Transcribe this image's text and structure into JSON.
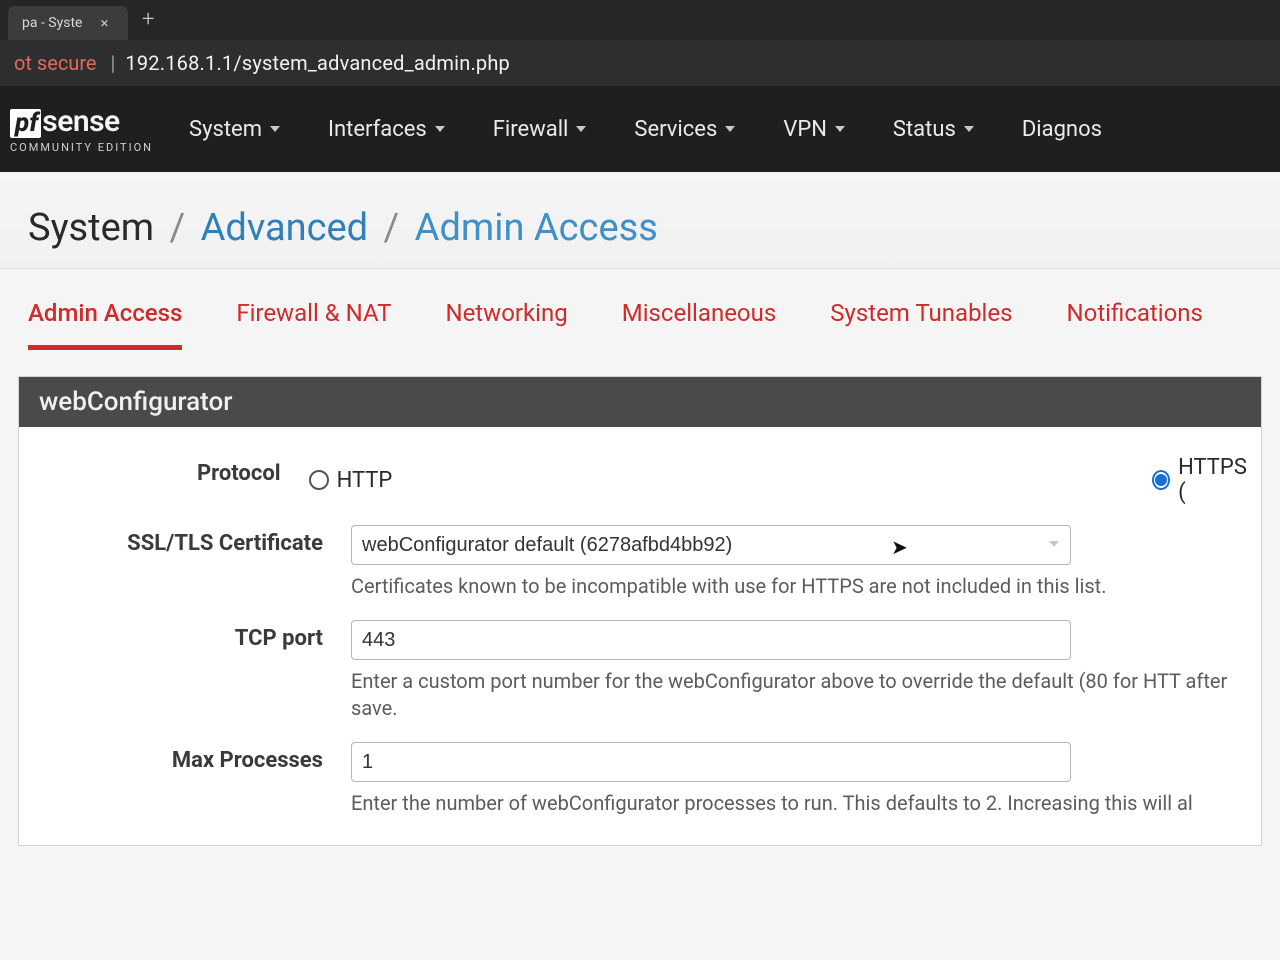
{
  "browser": {
    "tab_title": "pa - Syste",
    "security_label": "ot secure",
    "url": "192.168.1.1/system_advanced_admin.php"
  },
  "brand": {
    "prefix": "pf",
    "name": "sense",
    "edition": "COMMUNITY EDITION"
  },
  "nav": {
    "items": [
      "System",
      "Interfaces",
      "Firewall",
      "Services",
      "VPN",
      "Status",
      "Diagnos"
    ]
  },
  "breadcrumb": {
    "root": "System",
    "mid": "Advanced",
    "leaf": "Admin Access"
  },
  "sub_tabs": [
    "Admin Access",
    "Firewall & NAT",
    "Networking",
    "Miscellaneous",
    "System Tunables",
    "Notifications"
  ],
  "active_sub_tab_index": 0,
  "panel": {
    "title": "webConfigurator",
    "protocol": {
      "label": "Protocol",
      "option_http": "HTTP",
      "option_https": "HTTPS (",
      "selected": "https"
    },
    "ssl": {
      "label": "SSL/TLS Certificate",
      "value": "webConfigurator default (6278afbd4bb92)",
      "help": "Certificates known to be incompatible with use for HTTPS are not included in this list."
    },
    "tcp_port": {
      "label": "TCP port",
      "value": "443",
      "help": "Enter a custom port number for the webConfigurator above to override the default (80 for HTT after save."
    },
    "max_proc": {
      "label": "Max Processes",
      "value": "1",
      "help": "Enter the number of webConfigurator processes to run. This defaults to 2. Increasing this will al"
    }
  }
}
